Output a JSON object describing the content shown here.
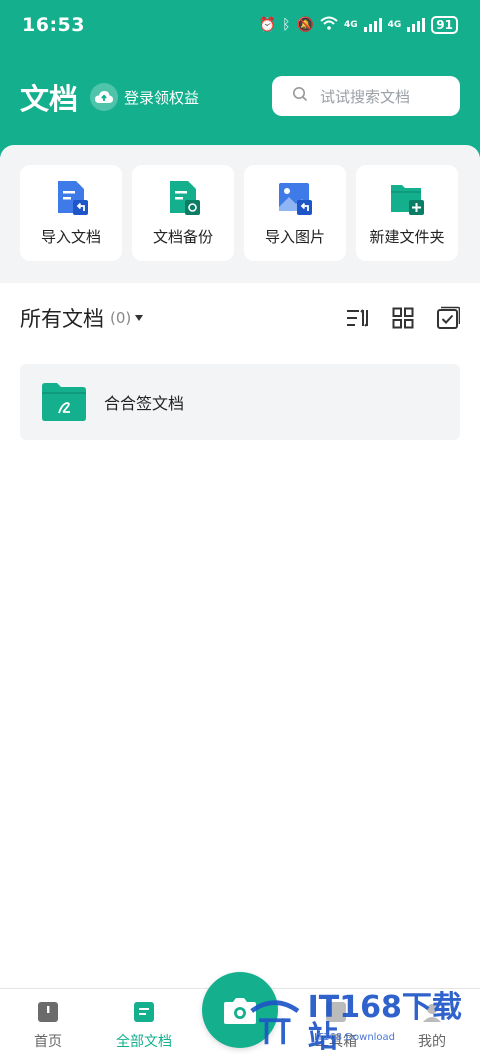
{
  "status_bar": {
    "time": "16:53",
    "battery": "91",
    "net1": "4G",
    "net2": "4G"
  },
  "header": {
    "title": "文档",
    "login_label": "登录领权益"
  },
  "search": {
    "placeholder": "试试搜索文档"
  },
  "quick_actions": [
    {
      "label": "导入文档",
      "icon": "import-doc-icon"
    },
    {
      "label": "文档备份",
      "icon": "backup-doc-icon"
    },
    {
      "label": "导入图片",
      "icon": "import-image-icon"
    },
    {
      "label": "新建文件夹",
      "icon": "new-folder-icon"
    }
  ],
  "section": {
    "title": "所有文档",
    "count": "(0)"
  },
  "folders": [
    {
      "name": "合合签文档"
    }
  ],
  "bottom_nav": {
    "home": "首页",
    "docs": "全部文档",
    "tools": "工具箱",
    "me": "我的"
  },
  "watermark": {
    "brand": "IT168下载站",
    "sub": "IT168 Download"
  },
  "colors": {
    "accent": "#14b08e",
    "doc_blue": "#3f7be8",
    "panel": "#f3f4f6"
  }
}
